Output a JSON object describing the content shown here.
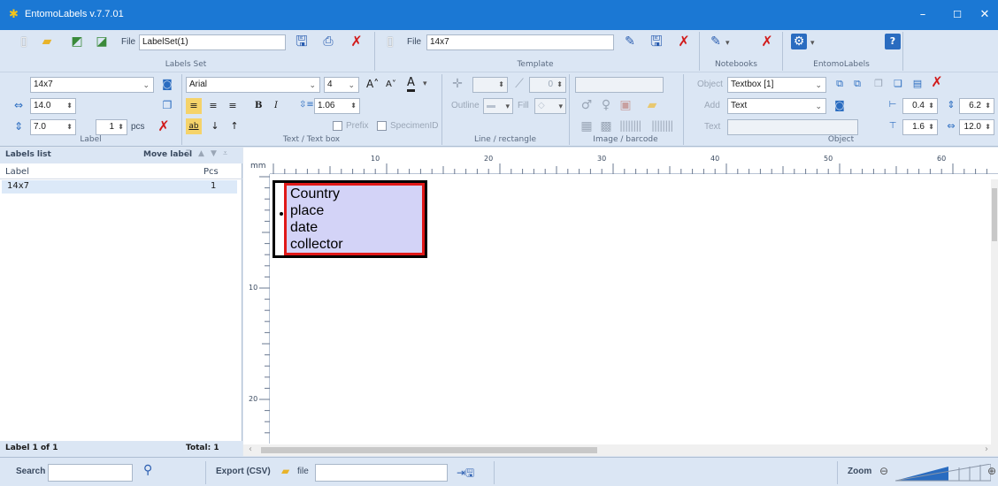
{
  "window": {
    "title": "EntomoLabels v.7.7.01",
    "minimize": "–",
    "maximize": "☐",
    "close": "✕"
  },
  "ribbon": {
    "labels_set": {
      "file_label": "File",
      "file_value": "LabelSet(1)",
      "group": "Labels Set"
    },
    "template": {
      "file_label": "File",
      "file_value": "14x7",
      "group": "Template"
    },
    "notebooks": {
      "group": "Notebooks"
    },
    "entomolabels": {
      "group": "EntomoLabels"
    },
    "label": {
      "group": "Label",
      "template_select": "14x7",
      "width": "14.0",
      "height": "7.0",
      "pcs_value": "1",
      "pcs_label": "pcs"
    },
    "textbox": {
      "group": "Text / Text box",
      "font": "Arial",
      "size": "4",
      "line_spacing": "1.06",
      "bold": "B",
      "italic": "I",
      "prefix": "Prefix",
      "specimen_id": "SpecimenID"
    },
    "line": {
      "group": "Line / rectangle",
      "spin": "0",
      "outline": "Outline",
      "fill": "Fill"
    },
    "image": {
      "group": "Image / barcode"
    },
    "object": {
      "group": "Object",
      "object_label": "Object",
      "object_value": "Textbox [1]",
      "add_label": "Add",
      "add_value": "Text",
      "text_label": "Text",
      "val1": "0.4",
      "val2": "6.2",
      "val3": "1.6",
      "val4": "12.0"
    }
  },
  "labels_list": {
    "title": "Labels list",
    "move_label": "Move label",
    "col_label": "Label",
    "col_pcs": "Pcs",
    "rows": [
      {
        "label": "14x7",
        "pcs": "1"
      }
    ],
    "footer_left": "Label  1  of  1",
    "footer_total": "Total: 1"
  },
  "canvas": {
    "unit": "mm",
    "ruler_top": [
      "10",
      "20",
      "30",
      "40",
      "50",
      "60"
    ],
    "ruler_left": [
      "10",
      "20"
    ],
    "label_text": [
      "Country",
      "place",
      "date",
      "collector"
    ]
  },
  "status": {
    "search_label": "Search",
    "export_label": "Export (CSV)",
    "file_label": "file",
    "zoom_label": "Zoom"
  },
  "colors": {
    "titlebar": "#1b78d4",
    "ribbon": "#dbe6f4",
    "textbox_border": "#e01818",
    "textbox_fill": "#d3d3f7"
  }
}
